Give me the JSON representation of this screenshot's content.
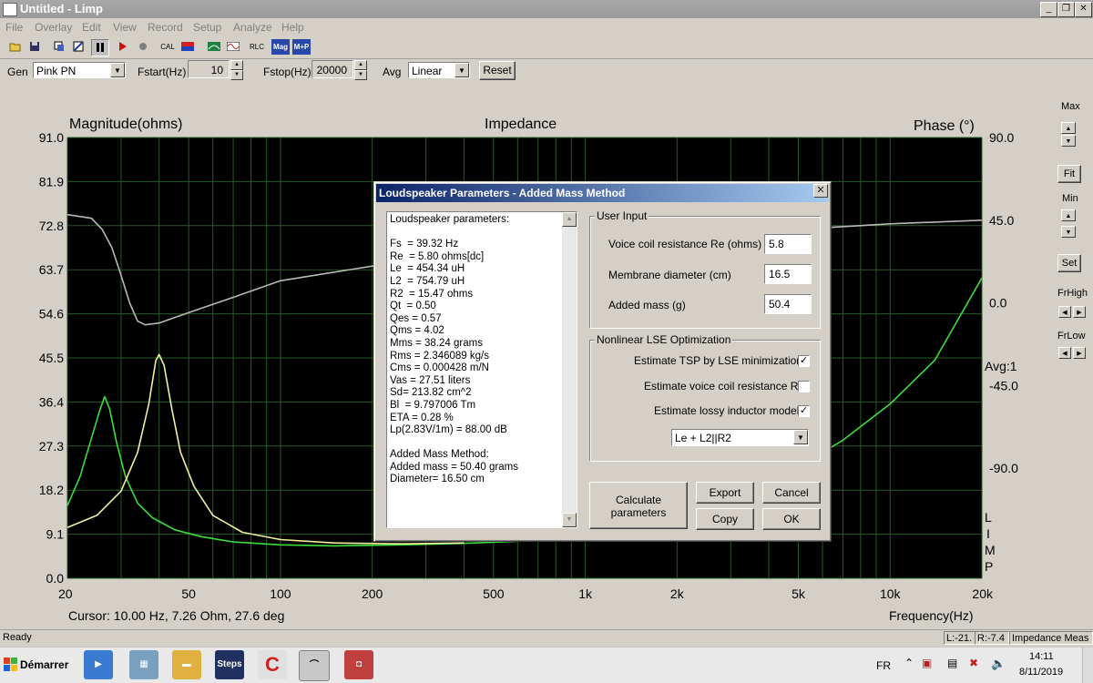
{
  "window": {
    "title": "Untitled - Limp"
  },
  "menu": [
    "File",
    "Overlay",
    "Edit",
    "View",
    "Record",
    "Setup",
    "Analyze",
    "Help"
  ],
  "toolbar": {
    "cal": "CAL",
    "rlc": "RLC",
    "mag": "Mag",
    "mp": "M+P"
  },
  "gen": {
    "gen_label": "Gen",
    "gen_value": "Pink PN",
    "fstart_label": "Fstart(Hz)",
    "fstart_value": "10",
    "fstop_label": "Fstop(Hz)",
    "fstop_value": "20000",
    "avg_label": "Avg",
    "avg_value": "Linear",
    "reset_label": "Reset"
  },
  "plot": {
    "title": "Impedance",
    "left_axis_label": "Magnitude(ohms)",
    "right_axis_label": "Phase (°)",
    "x_axis_label": "Frequency(Hz)",
    "cursor": "Cursor: 10.00 Hz, 7.26 Ohm, 27.6 deg",
    "avg": "Avg:1",
    "limp_letters": [
      "L",
      "I",
      "M",
      "P"
    ]
  },
  "chart_data": {
    "type": "line",
    "title": "Impedance",
    "xlabel": "Frequency(Hz)",
    "ylabel": "Magnitude(ohms)",
    "y2label": "Phase (°)",
    "xscale": "log",
    "xlim": [
      20,
      20000
    ],
    "ylim": [
      0.0,
      91.0
    ],
    "y2lim": [
      -150.0,
      90.0
    ],
    "x_ticks": [
      "20",
      "50",
      "100",
      "200",
      "500",
      "1k",
      "2k",
      "5k",
      "10k",
      "20k"
    ],
    "x_tick_values": [
      20,
      50,
      100,
      200,
      500,
      1000,
      2000,
      5000,
      10000,
      20000
    ],
    "y_ticks": [
      "0.0",
      "9.1",
      "18.2",
      "27.3",
      "36.4",
      "45.5",
      "54.6",
      "63.7",
      "72.8",
      "81.9",
      "91.0"
    ],
    "y2_ticks": [
      "90.0",
      "45.0",
      "0.0",
      "-45.0",
      "-90.0"
    ],
    "grid": true,
    "series": [
      {
        "color": "#3ddc3d",
        "axis": "left",
        "points": [
          [
            20,
            15
          ],
          [
            22,
            21
          ],
          [
            24,
            29
          ],
          [
            25.5,
            34.5
          ],
          [
            26.5,
            37.5
          ],
          [
            27.5,
            35
          ],
          [
            29,
            28
          ],
          [
            31,
            21
          ],
          [
            34,
            15.5
          ],
          [
            38,
            12.5
          ],
          [
            45,
            10
          ],
          [
            55,
            8.6
          ],
          [
            70,
            7.5
          ],
          [
            100,
            6.9
          ],
          [
            150,
            6.7
          ],
          [
            250,
            6.9
          ],
          [
            400,
            7.2
          ],
          [
            700,
            7.8
          ],
          [
            1000,
            8.5
          ],
          [
            2000,
            12
          ],
          [
            3000,
            16
          ],
          [
            5000,
            23
          ],
          [
            7000,
            28.5
          ],
          [
            10000,
            36
          ],
          [
            14000,
            45
          ],
          [
            20000,
            62
          ]
        ]
      },
      {
        "color": "#f0f0a0",
        "axis": "left",
        "points": [
          [
            20,
            10.5
          ],
          [
            25,
            13
          ],
          [
            30,
            18
          ],
          [
            34,
            26
          ],
          [
            37,
            36
          ],
          [
            39,
            45
          ],
          [
            40,
            46.2
          ],
          [
            41.5,
            44
          ],
          [
            44,
            35
          ],
          [
            47,
            26
          ],
          [
            52,
            19
          ],
          [
            60,
            13
          ],
          [
            75,
            9.5
          ],
          [
            100,
            8
          ],
          [
            150,
            7.3
          ],
          [
            250,
            7.1
          ],
          [
            400,
            7.3
          ]
        ]
      },
      {
        "color": "#b8b8b8",
        "axis": "right",
        "points": [
          [
            20,
            48
          ],
          [
            24,
            46
          ],
          [
            26,
            40
          ],
          [
            28,
            30
          ],
          [
            30,
            15
          ],
          [
            32,
            0
          ],
          [
            34,
            -10
          ],
          [
            36,
            -12
          ],
          [
            40,
            -11
          ],
          [
            45,
            -8
          ],
          [
            55,
            -3
          ],
          [
            70,
            3
          ],
          [
            100,
            12
          ],
          [
            200,
            20
          ],
          [
            400,
            25
          ],
          [
            1000,
            32
          ],
          [
            2000,
            36
          ],
          [
            5000,
            40
          ],
          [
            10000,
            43
          ],
          [
            20000,
            45
          ]
        ]
      }
    ]
  },
  "right": {
    "max": "Max",
    "fit": "Fit",
    "min": "Min",
    "set": "Set",
    "frhigh": "FrHigh",
    "frlow": "FrLow"
  },
  "status": {
    "ready": "Ready",
    "l": "L:-21.",
    "r": "R:-7.4",
    "mode": "Impedance Meas"
  },
  "taskbar": {
    "start": "Démarrer",
    "steps": "Steps",
    "lang": "FR",
    "time": "14:11",
    "date": "8/11/2019"
  },
  "dialog": {
    "title": "Loudspeaker Parameters - Added Mass Method",
    "close": "✕",
    "params_lines": [
      "Loudspeaker parameters:",
      "",
      "Fs  = 39.32 Hz",
      "Re  = 5.80 ohms[dc]",
      "Le  = 454.34 uH",
      "L2  = 754.79 uH",
      "R2  = 15.47 ohms",
      "Qt  = 0.50",
      "Qes = 0.57",
      "Qms = 4.02",
      "Mms = 38.24 grams",
      "Rms = 2.346089 kg/s",
      "Cms = 0.000428 m/N",
      "Vas = 27.51 liters",
      "Sd= 213.82 cm^2",
      "Bl  = 9.797006 Tm",
      "ETA = 0.28 %",
      "Lp(2.83V/1m) = 88.00 dB",
      "",
      "Added Mass Method:",
      "Added mass = 50.40 grams",
      "Diameter= 16.50 cm"
    ],
    "user_input": {
      "title": "User Input",
      "re_label": "Voice coil resistance Re (ohms)",
      "re_value": "5.8",
      "diam_label": "Membrane diameter (cm)",
      "diam_value": "16.5",
      "mass_label": "Added mass (g)",
      "mass_value": "50.4"
    },
    "lse": {
      "title": "Nonlinear LSE Optimization",
      "tsp_label": "Estimate TSP by LSE minimization",
      "tsp_checked": true,
      "re_label": "Estimate voice coil resistance Re",
      "re_checked": false,
      "lossy_label": "Estimate lossy inductor model",
      "lossy_checked": true,
      "model_value": "Le + L2||R2"
    },
    "buttons": {
      "calculate": "Calculate parameters",
      "export": "Export",
      "cancel": "Cancel",
      "copy": "Copy",
      "ok": "OK"
    }
  }
}
